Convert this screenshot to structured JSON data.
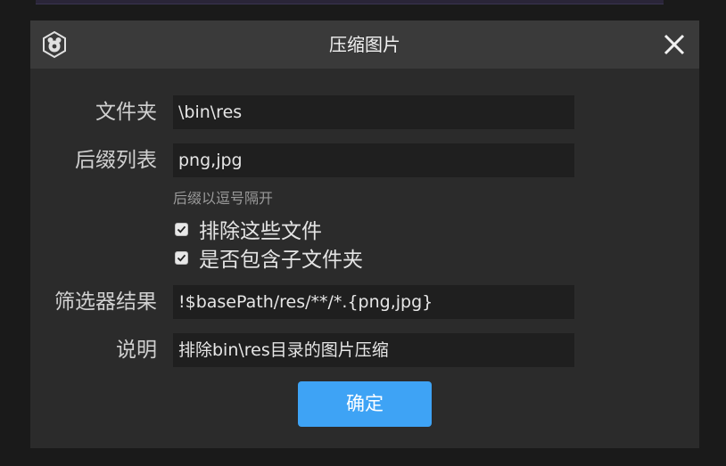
{
  "dialog": {
    "title": "压缩图片",
    "folder_label": "文件夹",
    "folder_value": "\\bin\\res",
    "suffix_label": "后缀列表",
    "suffix_value": "png,jpg",
    "suffix_hint": "后缀以逗号隔开",
    "exclude_label": "排除这些文件",
    "exclude_checked": true,
    "subfolder_label": "是否包含子文件夹",
    "subfolder_checked": true,
    "filter_label": "筛选器结果",
    "filter_value": "!$basePath/res/**/*.{png,jpg}",
    "desc_label": "说明",
    "desc_value": "排除bin\\res目录的图片压缩",
    "ok_label": "确定"
  },
  "colors": {
    "accent": "#3ea3f5",
    "dialog_bg": "#2b2b2b",
    "titlebar_bg": "#3a3a3a",
    "field_bg": "#1f1f1f"
  },
  "icons": [
    "app-logo-icon",
    "close-icon",
    "checkmark-icon"
  ]
}
